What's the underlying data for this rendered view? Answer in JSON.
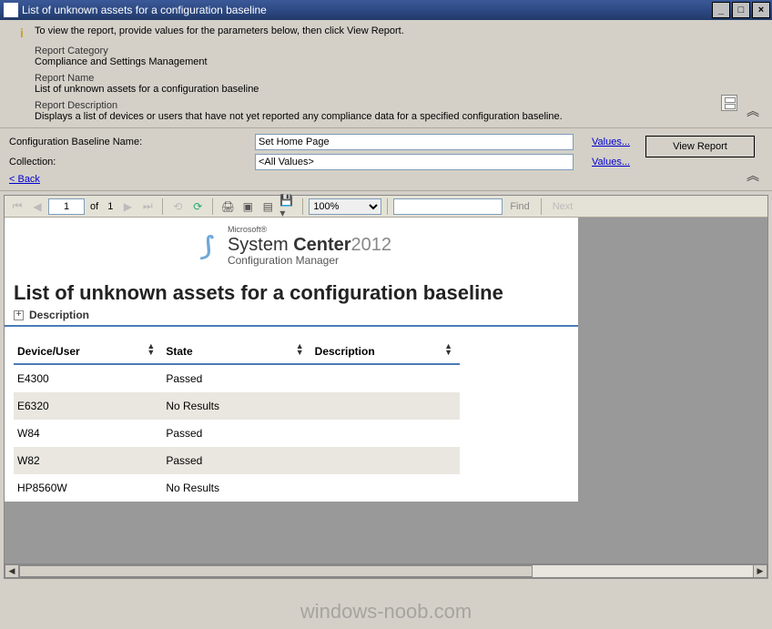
{
  "window": {
    "title": "List of unknown assets for a configuration baseline"
  },
  "header": {
    "info_text": "To view the report, provide values for the parameters below, then click View Report.",
    "category_label": "Report Category",
    "category_value": "Compliance and Settings Management",
    "name_label": "Report Name",
    "name_value": "List of unknown assets for a configuration baseline",
    "desc_label": "Report Description",
    "desc_value": "Displays a list of devices or users that have not yet reported any compliance data for a specified configuration baseline."
  },
  "params": {
    "baseline_label": "Configuration Baseline Name:",
    "baseline_value": "Set Home Page",
    "collection_label": "Collection:",
    "collection_value": "<All Values>",
    "values_link": "Values...",
    "back_link": "< Back",
    "view_report": "View Report"
  },
  "toolbar": {
    "page_current": "1",
    "page_of": "of",
    "page_total": "1",
    "zoom": "100%",
    "find": "Find",
    "next": "Next",
    "find_placeholder": ""
  },
  "report": {
    "logo_micro": "Microsoft®",
    "logo_main_a": "System",
    "logo_main_b": "Center",
    "logo_year": "2012",
    "logo_sub": "Configuration Manager",
    "title": "List of unknown assets for a configuration baseline",
    "desc_label": "Description",
    "columns": {
      "c0": "Device/User",
      "c1": "State",
      "c2": "Description"
    },
    "rows": [
      {
        "device": "E4300",
        "state": "Passed",
        "desc": ""
      },
      {
        "device": "E6320",
        "state": "No Results",
        "desc": ""
      },
      {
        "device": "W84",
        "state": "Passed",
        "desc": ""
      },
      {
        "device": "W82",
        "state": "Passed",
        "desc": ""
      },
      {
        "device": "HP8560W",
        "state": "No Results",
        "desc": ""
      }
    ]
  },
  "watermark": "windows-noob.com"
}
